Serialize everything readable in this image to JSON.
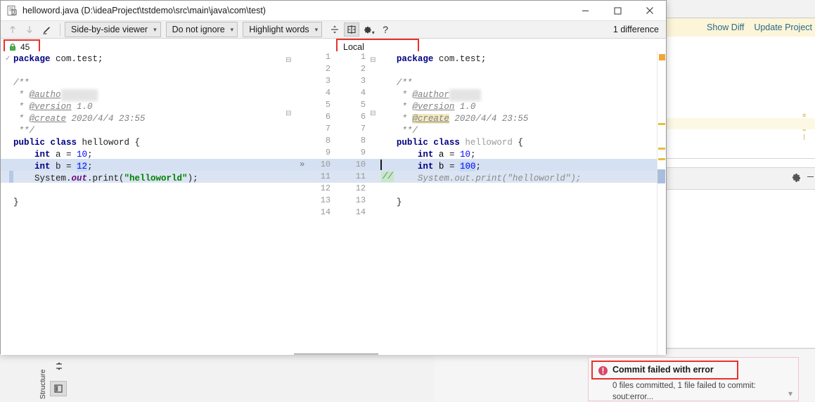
{
  "ide_background": {
    "notification_bar": {
      "links": [
        {
          "label": "Show Diff",
          "highlighted": true
        },
        {
          "label": "Update Project",
          "highlighted": false
        }
      ]
    },
    "structure_tool_tab": "Structure",
    "icons": [
      "gear-icon",
      "minimize-icon",
      "expand-all-icon",
      "structure-icon"
    ]
  },
  "dialog": {
    "title": "helloword.java (D:\\ideaProject\\tstdemo\\src\\main\\java\\com\\test)",
    "title_icon": "java-file-icon",
    "window_buttons": {
      "minimize": "─",
      "maximize": "□",
      "close": "✕"
    },
    "toolbar": {
      "prev_difference": "↑",
      "next_difference": "↓",
      "edit_source": "pencil-icon",
      "viewer_mode": "Side-by-side viewer",
      "ignore_policy": "Do not ignore",
      "highlight_mode": "Highlight words",
      "collapse_unchanged": "collapse-icon",
      "synchronize_scroll": "sync-scroll-icon",
      "settings": "gear-icon",
      "help": "?",
      "difference_count": "1 difference"
    },
    "panes": {
      "left": {
        "header_badge": "45",
        "header_badge_icon": "lock-icon",
        "lines": [
          {
            "n": 1,
            "html": "<span class=\"kw\">package</span> com.test;"
          },
          {
            "n": 2,
            "html": ""
          },
          {
            "n": 3,
            "html": "<span class=\"cmt\">/**</span>"
          },
          {
            "n": 4,
            "html": "<span class=\"cmt\"> * </span><span class=\"tag\">@autho</span><span class=\"blurred\">r  xxxx</span>"
          },
          {
            "n": 5,
            "html": "<span class=\"cmt\"> * </span><span class=\"tag\">@version</span><span class=\"cmt\"> 1.0</span>"
          },
          {
            "n": 6,
            "html": "<span class=\"cmt\"> * </span><span class=\"tag\">@create</span><span class=\"cmt\"> 2020/4/4 23:55</span>"
          },
          {
            "n": 7,
            "html": "<span class=\"cmt\"> **/</span>"
          },
          {
            "n": 8,
            "html": "<span class=\"kw\">public class</span> helloword {"
          },
          {
            "n": 9,
            "html": "    <span class=\"kw\">int</span> a = <span class=\"num\">10</span>;"
          },
          {
            "n": 10,
            "html": "    <span class=\"kw\">int</span> b = <span class=\"numhl\">12</span>;"
          },
          {
            "n": 11,
            "html": "    System.<span class=\"fld\">out</span>.print(<span class=\"str\">\"helloworld\"</span>);"
          },
          {
            "n": 12,
            "html": ""
          },
          {
            "n": 13,
            "html": "}"
          },
          {
            "n": 14,
            "html": ""
          }
        ]
      },
      "right": {
        "header_label": "Local",
        "lines": [
          {
            "n": 1,
            "html": "<span class=\"kw\">package</span> com.test;"
          },
          {
            "n": 2,
            "html": ""
          },
          {
            "n": 3,
            "html": "<span class=\"cmt\">/**</span>"
          },
          {
            "n": 4,
            "html": "<span class=\"cmt\"> * </span><span class=\"tag\">@author</span><span class=\"blurred\">  xxxx</span>"
          },
          {
            "n": 5,
            "html": "<span class=\"cmt\"> * </span><span class=\"tag\">@version</span><span class=\"cmt\"> 1.0</span>"
          },
          {
            "n": 6,
            "html": "<span class=\"cmt\"> * </span><span class=\"tag hl-create\">@create</span><span class=\"cmt\"> 2020/4/4 23:55</span>"
          },
          {
            "n": 7,
            "html": "<span class=\"cmt\"> **/</span>"
          },
          {
            "n": 8,
            "html": "<span class=\"kw\">public class</span> <span class=\"greyed\">helloword</span> {"
          },
          {
            "n": 9,
            "html": "    <span class=\"kw\">int</span> <span class=\"plain\">a</span> = <span class=\"num\">10</span>;"
          },
          {
            "n": 10,
            "html": "    <span class=\"kw\">int</span> <span class=\"plain\">b</span> = <span class=\"numhl\">100</span>;"
          },
          {
            "n": 11,
            "html": "<span class=\"cmt-line\">    System.out.print(\"helloworld\");</span>"
          },
          {
            "n": 12,
            "html": ""
          },
          {
            "n": 13,
            "html": "}"
          },
          {
            "n": 14,
            "html": ""
          }
        ],
        "commented_marker": "//"
      },
      "line_numbers": [
        1,
        2,
        3,
        4,
        5,
        6,
        7,
        8,
        9,
        10,
        11,
        12,
        13,
        14
      ],
      "changed_line": 10,
      "change_marker": "»"
    }
  },
  "notification_popup": {
    "icon": "error-icon",
    "title": "Commit failed with error",
    "detail_line1": "0 files committed, 1 file failed to commit:",
    "detail_line2": "sout:error...",
    "collapse_icon": "chevron-down-icon"
  },
  "colors": {
    "accent_red": "#e8312b",
    "link_blue": "#2a6a8a",
    "notif_yellow": "#fcf5d8",
    "diff_highlight": "#d5e0f2",
    "keyword": "#000080",
    "string": "#008000",
    "number": "#0000ff"
  }
}
